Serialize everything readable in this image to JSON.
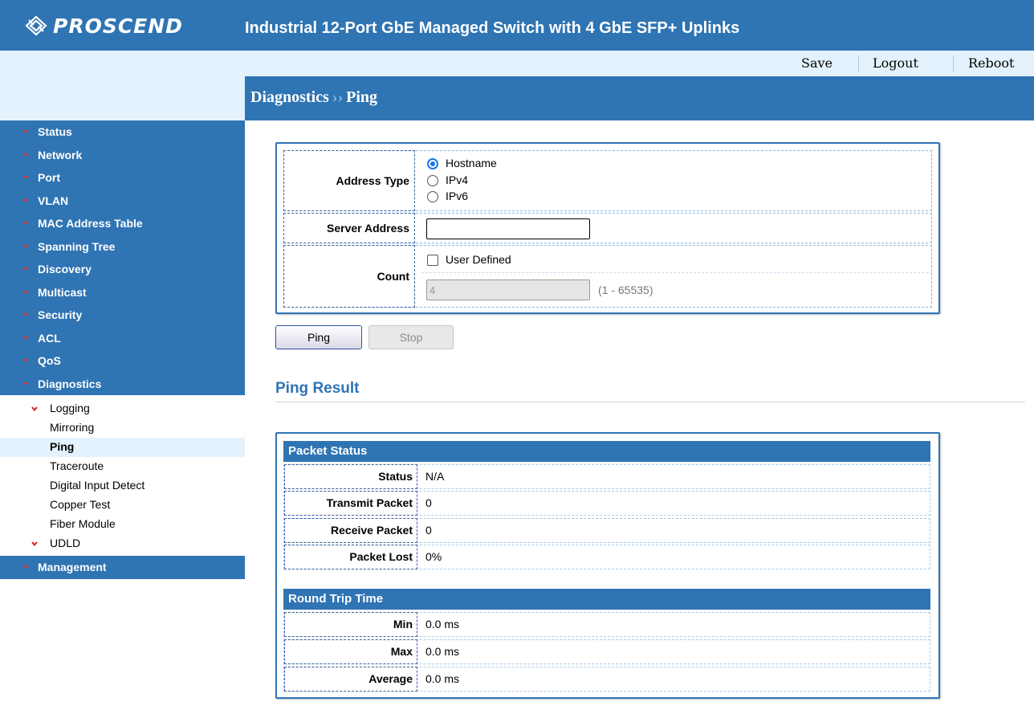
{
  "header": {
    "brand": "PROSCEND",
    "product_title": "Industrial 12-Port GbE Managed Switch with 4 GbE SFP+ Uplinks",
    "accent_color": "#2f74b3"
  },
  "toplinks": {
    "save": "Save",
    "logout": "Logout",
    "reboot": "Reboot"
  },
  "breadcrumb": {
    "section": "Diagnostics",
    "separator": "››",
    "page": "Ping"
  },
  "sidebar": {
    "items": [
      {
        "label": "Status"
      },
      {
        "label": "Network"
      },
      {
        "label": "Port"
      },
      {
        "label": "VLAN"
      },
      {
        "label": "MAC Address Table"
      },
      {
        "label": "Spanning Tree"
      },
      {
        "label": "Discovery"
      },
      {
        "label": "Multicast"
      },
      {
        "label": "Security"
      },
      {
        "label": "ACL"
      },
      {
        "label": "QoS"
      },
      {
        "label": "Diagnostics"
      }
    ],
    "diagnostics_sub": [
      {
        "label": "Logging"
      },
      {
        "label": "Mirroring"
      },
      {
        "label": "Ping"
      },
      {
        "label": "Traceroute"
      },
      {
        "label": "Digital Input Detect"
      },
      {
        "label": "Copper Test"
      },
      {
        "label": "Fiber Module"
      },
      {
        "label": "UDLD"
      }
    ],
    "management": "Management",
    "active_sub": "Ping"
  },
  "form": {
    "address_type_label": "Address Type",
    "address_options": [
      "Hostname",
      "IPv4",
      "IPv6"
    ],
    "selected_address": "Hostname",
    "server_address_label": "Server Address",
    "server_address_value": "",
    "count_label": "Count",
    "user_defined_label": "User Defined",
    "user_defined_checked": false,
    "count_value": "4",
    "count_range": "(1 - 65535)",
    "ping_button": "Ping",
    "stop_button": "Stop"
  },
  "result": {
    "title": "Ping Result",
    "packet_status_head": "Packet Status",
    "packet_rows": [
      {
        "label": "Status",
        "value": "N/A"
      },
      {
        "label": "Transmit Packet",
        "value": "0"
      },
      {
        "label": "Receive Packet",
        "value": "0"
      },
      {
        "label": "Packet Lost",
        "value": "0%"
      }
    ],
    "rtt_head": "Round Trip Time",
    "rtt_rows": [
      {
        "label": "Min",
        "value": "0.0 ms"
      },
      {
        "label": "Max",
        "value": "0.0 ms"
      },
      {
        "label": "Average",
        "value": "0.0 ms"
      }
    ]
  }
}
